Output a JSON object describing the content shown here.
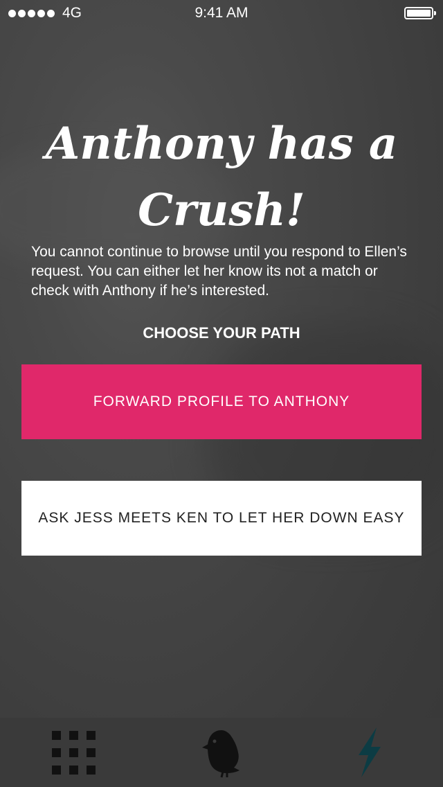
{
  "status_bar": {
    "network": "4G",
    "time": "9:41 AM"
  },
  "headline": "Anthony has a Crush!",
  "message": "You cannot continue to browse until you respond to Ellen’s request. You can either let her know its not a match or check with Anthony if he’s interested.",
  "path_title": "CHOOSE YOUR PATH",
  "buttons": {
    "forward": "FORWARD PROFILE TO ANTHONY",
    "let_down": "ASK JESS MEETS KEN TO LET HER DOWN EASY"
  },
  "tab_bar": {
    "tabs": [
      {
        "icon": "grid-icon"
      },
      {
        "icon": "bird-icon"
      },
      {
        "icon": "lightning-icon"
      }
    ]
  },
  "colors": {
    "primary_button": "#e0286a",
    "lightning_icon": "#0c3c44"
  }
}
